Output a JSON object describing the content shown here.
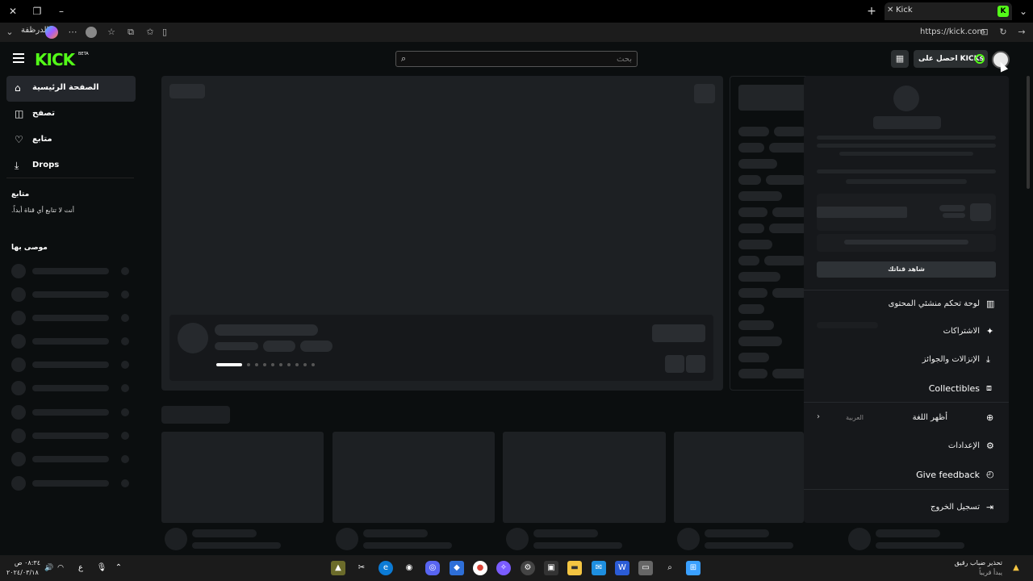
{
  "browser": {
    "tab_title": "Kick",
    "tab_favicon": "K",
    "url": "https://kick.com",
    "profile_label": "الدرظفة"
  },
  "header": {
    "logo": "KICK",
    "logo_badge": "BETA",
    "search_placeholder": "بحث",
    "kicks_button": "احصل على KICKs",
    "accent_color": "#53fc18"
  },
  "sidebar": {
    "nav": [
      {
        "label": "الصفحة الرئيسية",
        "icon": "home-icon"
      },
      {
        "label": "تصفح",
        "icon": "browse-icon"
      },
      {
        "label": "متابع",
        "icon": "heart-icon"
      },
      {
        "label": "Drops",
        "icon": "drops-icon"
      }
    ],
    "following_heading": "متابع",
    "following_empty": "أنت لا تتابع أي قناة أبداً.",
    "recommended_heading": "موصى بها"
  },
  "dropdown": {
    "watch_button": "شاهد قناتك",
    "items": [
      {
        "label": "لوحة تحكم منشئي المحتوى",
        "icon": "dashboard-icon"
      },
      {
        "label": "الاشتراكات",
        "icon": "sparkle-icon"
      },
      {
        "label": "الإنزالات والجوائز",
        "icon": "drops-icon"
      },
      {
        "label": "Collectibles",
        "icon": "collectibles-icon"
      },
      {
        "label": "أظهر اللغة",
        "icon": "globe-icon",
        "value": "العربية"
      },
      {
        "label": "الإعدادات",
        "icon": "gear-icon"
      },
      {
        "label": "Give feedback",
        "icon": "feedback-icon"
      },
      {
        "label": "تسجيل الخروج",
        "icon": "logout-icon"
      }
    ]
  },
  "taskbar": {
    "weather_line1": "تحذير ضباب رقيق",
    "weather_line2": "يبدأ قريباً",
    "time": "٠٨:٣٤ ص",
    "date": "٢٠٢٤/٠٣/١٨"
  }
}
